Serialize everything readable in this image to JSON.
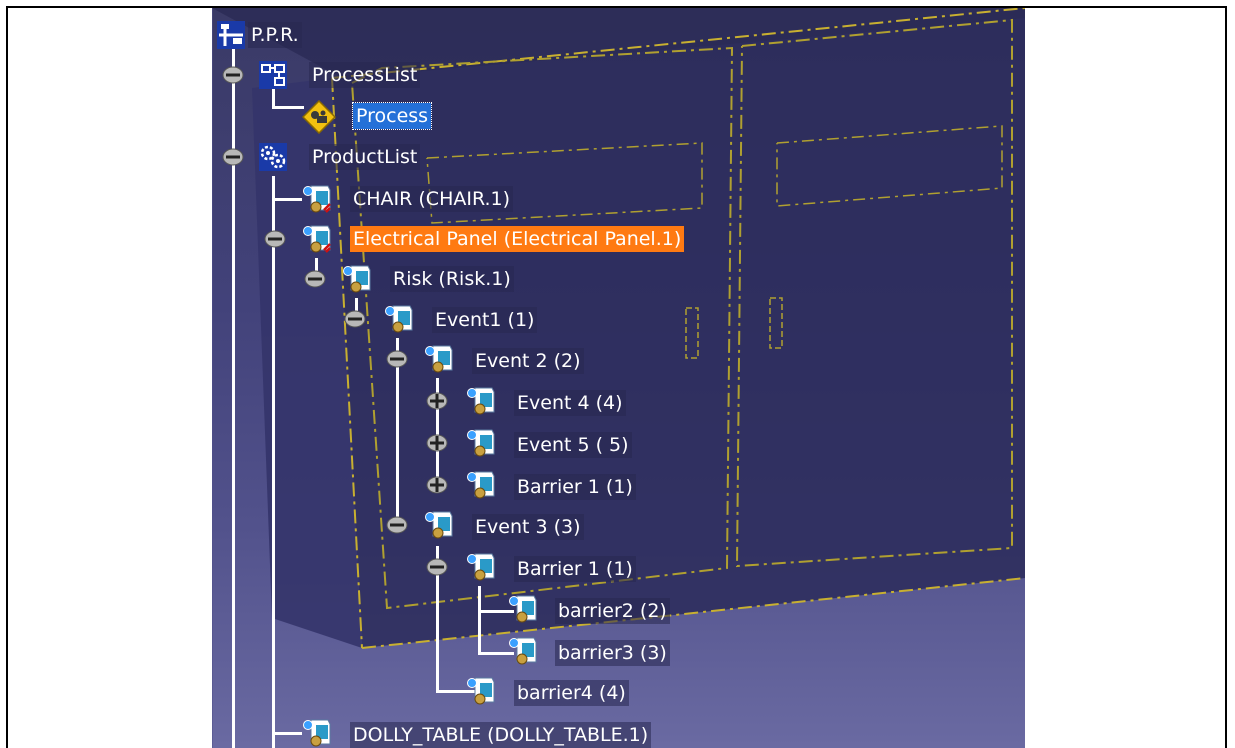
{
  "tree": {
    "root": {
      "label": "P.P.R."
    },
    "process_list": {
      "label": "ProcessList"
    },
    "process": {
      "label": "Process"
    },
    "product_list": {
      "label": "ProductList"
    },
    "chair": {
      "label": "CHAIR (CHAIR.1)"
    },
    "electrical_panel": {
      "label": "Electrical Panel (Electrical Panel.1)"
    },
    "risk": {
      "label": "Risk (Risk.1)"
    },
    "event1": {
      "label": "Event1 (1)"
    },
    "event2": {
      "label": "Event 2 (2)"
    },
    "event4": {
      "label": "Event 4 (4)"
    },
    "event5": {
      "label": "Event 5 ( 5)"
    },
    "barrier1_a": {
      "label": "Barrier 1 (1)"
    },
    "event3": {
      "label": "Event 3 (3)"
    },
    "barrier1_b": {
      "label": "Barrier 1 (1)"
    },
    "barrier2": {
      "label": "barrier2 (2)"
    },
    "barrier3": {
      "label": "barrier3 (3)"
    },
    "barrier4": {
      "label": "barrier4 (4)"
    },
    "dolly_table": {
      "label": "DOLLY_TABLE (DOLLY_TABLE.1)"
    }
  },
  "colors": {
    "selection": "#2470d8",
    "highlight": "#ff7a12",
    "background": "#42427a"
  }
}
